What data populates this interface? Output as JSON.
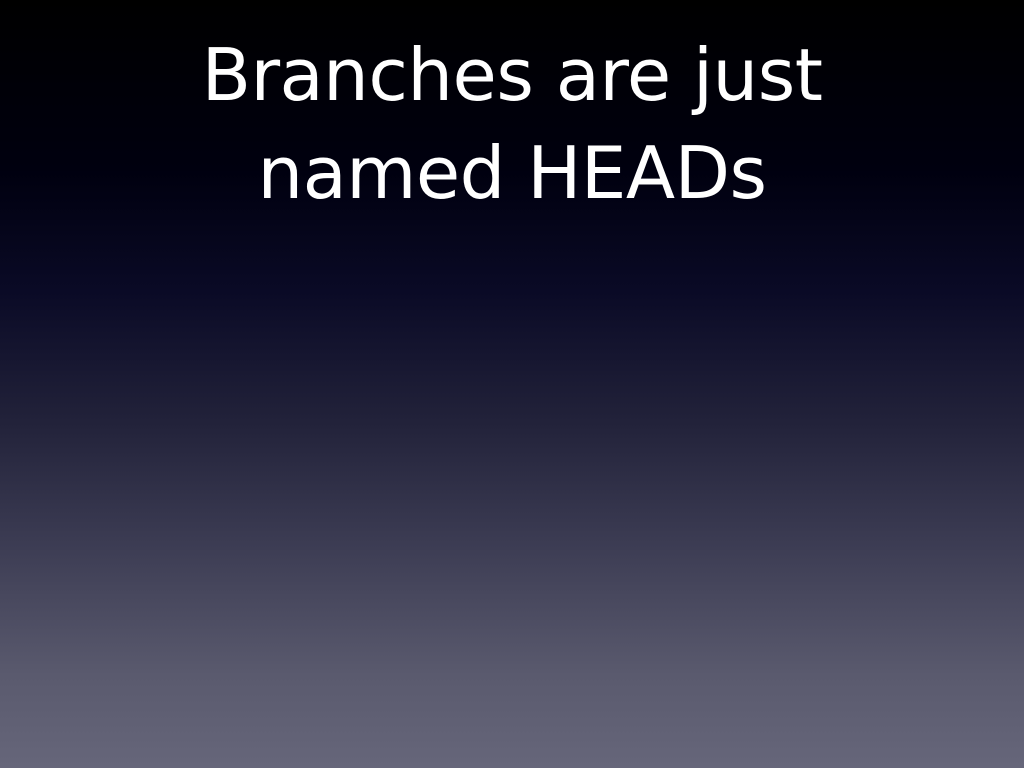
{
  "slide": {
    "title_line_1": "Branches are just",
    "title_line_2": "named HEADs"
  },
  "colors": {
    "title_text": "#ffffff",
    "background_top": "#000000",
    "background_bottom": "#66667a"
  }
}
